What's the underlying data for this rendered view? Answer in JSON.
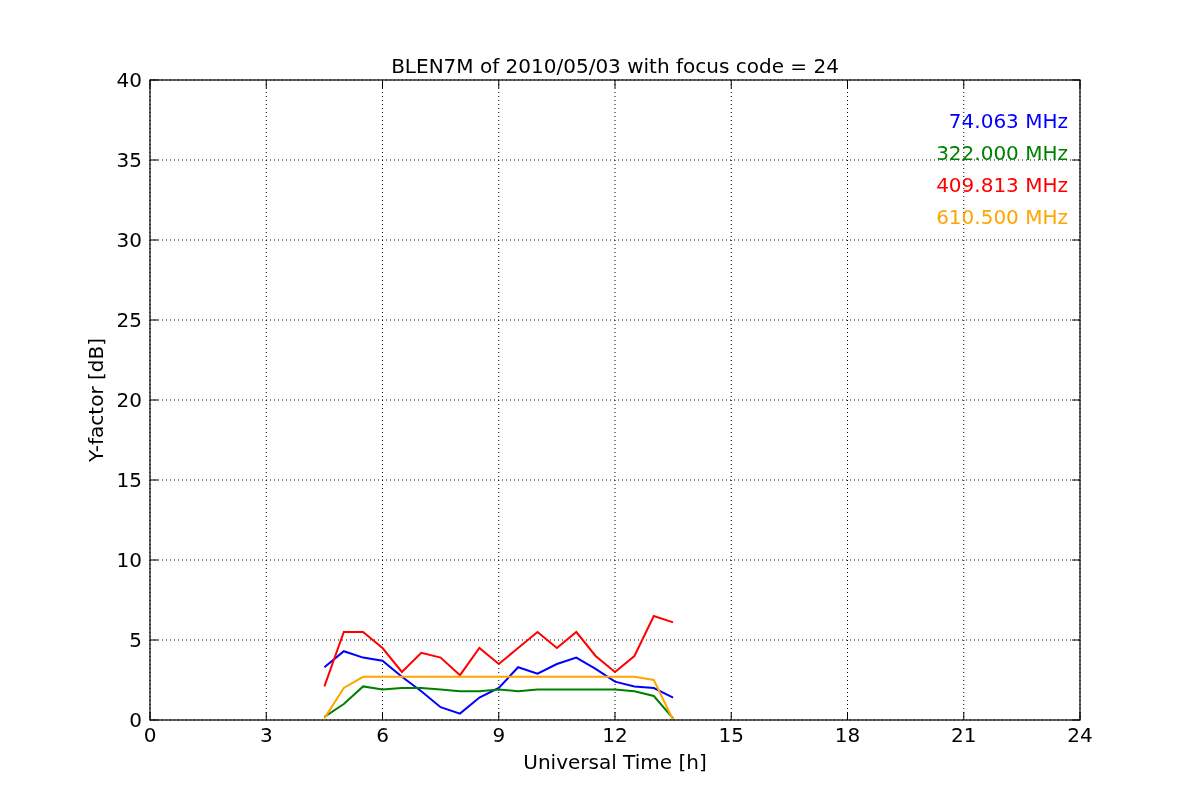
{
  "chart": {
    "chart_data": {
      "type": "line",
      "title": "BLEN7M of 2010/05/03 with focus code = 24",
      "xlabel": "Universal Time [h]",
      "ylabel": "Y-factor [dB]",
      "x": [
        4.5,
        5,
        5.5,
        6,
        6.5,
        7,
        7.5,
        8,
        8.5,
        9,
        9.5,
        10,
        10.5,
        11,
        11.5,
        12,
        12.5,
        13,
        13.5
      ],
      "series": [
        {
          "name": "74.063 MHz",
          "color": "#0000ff",
          "values": [
            3.3,
            4.3,
            3.9,
            3.7,
            2.7,
            1.8,
            0.8,
            0.4,
            1.4,
            2.0,
            3.3,
            2.9,
            3.5,
            3.9,
            3.2,
            2.4,
            2.1,
            2.0,
            1.4
          ]
        },
        {
          "name": "322.000 MHz",
          "color": "#008000",
          "values": [
            0.2,
            1.0,
            2.1,
            1.9,
            2.0,
            2.0,
            1.9,
            1.8,
            1.8,
            1.9,
            1.8,
            1.9,
            1.9,
            1.9,
            1.9,
            1.9,
            1.8,
            1.5,
            0.1
          ]
        },
        {
          "name": "409.813 MHz",
          "color": "#ff0000",
          "values": [
            2.1,
            5.5,
            5.5,
            4.5,
            3.0,
            4.2,
            3.9,
            2.8,
            4.5,
            3.5,
            4.5,
            5.5,
            4.5,
            5.5,
            4.0,
            3.0,
            4.0,
            6.5,
            6.1
          ]
        },
        {
          "name": "610.500 MHz",
          "color": "#ffa500",
          "values": [
            0.1,
            2.0,
            2.7,
            2.7,
            2.7,
            2.7,
            2.7,
            2.7,
            2.7,
            2.7,
            2.7,
            2.7,
            2.7,
            2.7,
            2.7,
            2.7,
            2.7,
            2.5,
            0.0
          ]
        }
      ],
      "xlim": [
        0,
        24
      ],
      "ylim": [
        0,
        40
      ],
      "xticks": [
        0,
        3,
        6,
        9,
        12,
        15,
        18,
        21,
        24
      ],
      "yticks": [
        0,
        5,
        10,
        15,
        20,
        25,
        30,
        35,
        40
      ],
      "grid": true
    }
  }
}
